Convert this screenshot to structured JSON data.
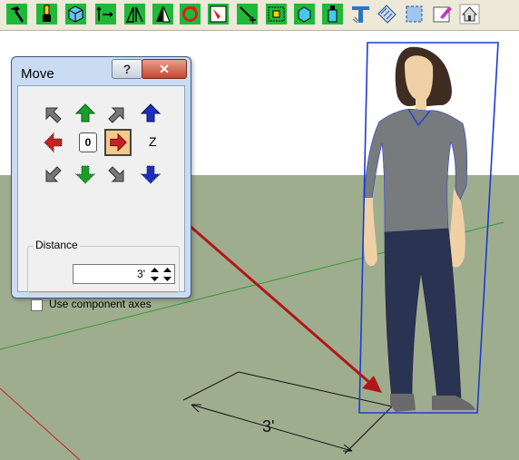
{
  "toolbar": {
    "buttons": [
      {
        "icon": "hammer-icon"
      },
      {
        "icon": "paint-brush-icon"
      },
      {
        "icon": "component-cube-icon"
      },
      {
        "icon": "move-icon"
      },
      {
        "icon": "flip-icon"
      },
      {
        "icon": "mirror-icon"
      },
      {
        "icon": "rotate-icon"
      },
      {
        "icon": "scale-icon"
      },
      {
        "icon": "pushpull-icon"
      },
      {
        "icon": "group-icon"
      },
      {
        "icon": "box-icon"
      },
      {
        "icon": "extrude-icon"
      },
      {
        "icon": "tape-measure-icon"
      },
      {
        "icon": "section-plane-icon"
      },
      {
        "icon": "select-icon"
      },
      {
        "icon": "edit-icon"
      },
      {
        "icon": "home-icon"
      }
    ]
  },
  "dialog": {
    "title": "Move",
    "help_label": "?",
    "close_label": "✕",
    "zero_label": "0",
    "z_label": "Z",
    "distance_label": "Distance",
    "distance_value": "3'",
    "checkbox_label": "Use component axes",
    "checkbox_checked": false
  },
  "scene": {
    "dimension_label": "3'",
    "colors": {
      "sky": "#ffffff",
      "ground": "#9fad8f",
      "axis_green": "#2f9e2f",
      "axis_red": "#c21f1f",
      "selection_blue": "#1a3bd6",
      "move_arrow": "#b01818"
    }
  }
}
